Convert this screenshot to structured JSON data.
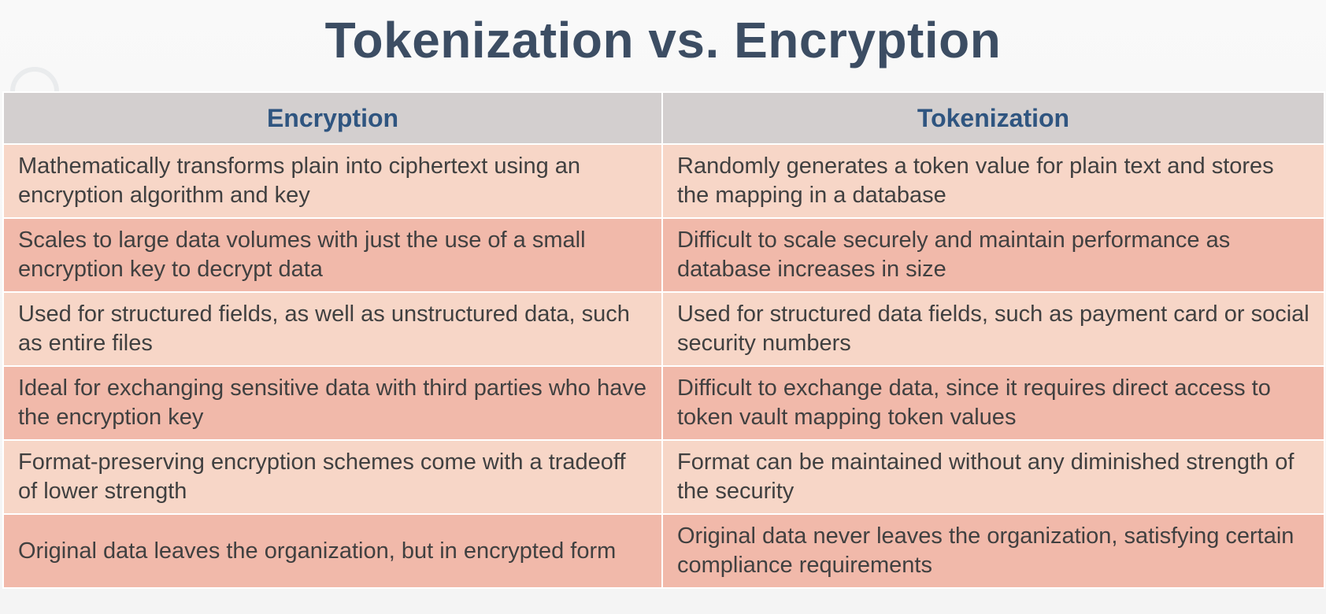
{
  "slide": {
    "title": "Tokenization vs. Encryption"
  },
  "table": {
    "headers": [
      "Encryption",
      "Tokenization"
    ],
    "rows": [
      [
        "Mathematically transforms plain into ciphertext using an encryption algorithm and key",
        "Randomly generates a token value for plain text and stores the mapping in a database"
      ],
      [
        "Scales to large data volumes with just the use of a small encryption key to decrypt data",
        "Difficult to scale securely and maintain performance as database increases in size"
      ],
      [
        "Used for structured fields, as well as unstructured data, such as entire files",
        "Used for structured data fields, such as payment card or social security numbers"
      ],
      [
        "Ideal for exchanging sensitive data with third parties who have the encryption key",
        "Difficult to exchange data, since it requires direct access to token vault mapping token values"
      ],
      [
        "Format-preserving encryption schemes come with a tradeoff of lower strength",
        "Format can be maintained without any diminished strength of the security"
      ],
      [
        "Original data leaves the organization, but in encrypted form",
        "Original data never leaves the organization, satisfying certain compliance requirements"
      ]
    ]
  },
  "colors": {
    "title": "#3c4d63",
    "header_bg": "#d3cfcf",
    "header_text": "#2f5580",
    "row_light": "#f7d6c7",
    "row_dark": "#f1b9aa"
  }
}
